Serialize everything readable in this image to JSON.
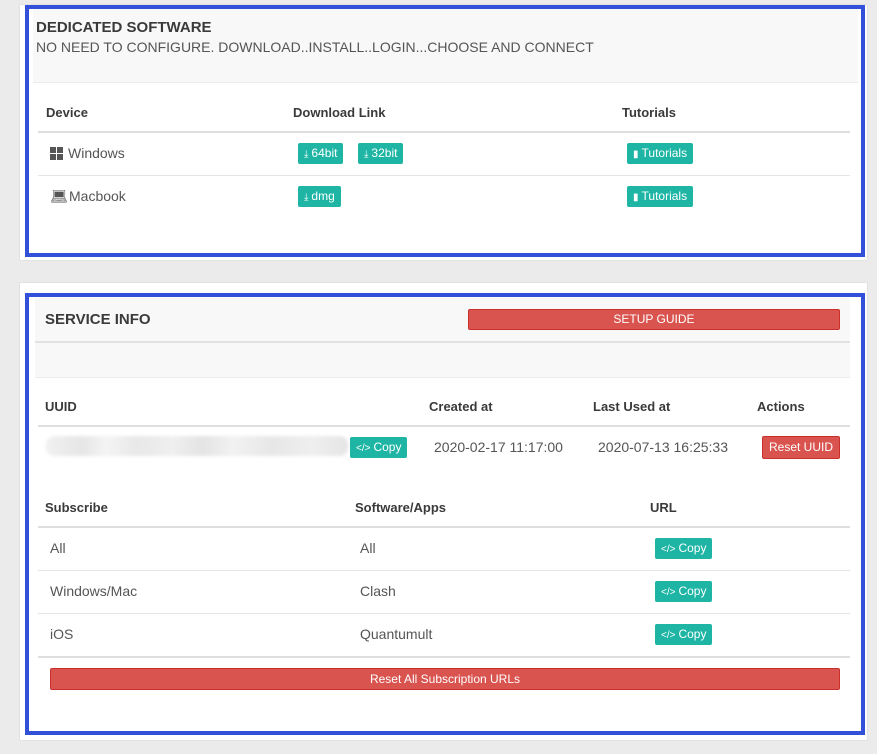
{
  "software": {
    "title": "DEDICATED SOFTWARE",
    "subtitle": "NO NEED TO CONFIGURE. DOWNLOAD..INSTALL..LOGIN...CHOOSE AND CONNECT",
    "columns": [
      "Device",
      "Download Link",
      "Tutorials"
    ],
    "rows": [
      {
        "device": "Windows",
        "icon": "windows-icon",
        "downloads": [
          "64bit",
          "32bit"
        ],
        "tutorial": "Tutorials"
      },
      {
        "device": "Macbook",
        "icon": "laptop-icon",
        "downloads": [
          "dmg"
        ],
        "tutorial": "Tutorials"
      }
    ]
  },
  "service": {
    "title": "SERVICE INFO",
    "setup_guide": "SETUP GUIDE",
    "uuid_columns": [
      "UUID",
      "Created at",
      "Last Used at",
      "Actions"
    ],
    "uuid_row": {
      "copy": "Copy",
      "created_at": "2020-02-17 11:17:00",
      "last_used_at": "2020-07-13 16:25:33",
      "reset": "Reset UUID"
    },
    "sub_columns": [
      "Subscribe",
      "Software/Apps",
      "URL"
    ],
    "sub_rows": [
      {
        "subscribe": "All",
        "app": "All",
        "copy": "Copy"
      },
      {
        "subscribe": "Windows/Mac",
        "app": "Clash",
        "copy": "Copy"
      },
      {
        "subscribe": "iOS",
        "app": "Quantumult",
        "copy": "Copy"
      }
    ],
    "reset_all": "Reset All Subscription URLs"
  },
  "colors": {
    "accent_teal": "#1eb5a5",
    "danger_red": "#d9534f",
    "highlight_frame": "#3350d8"
  }
}
